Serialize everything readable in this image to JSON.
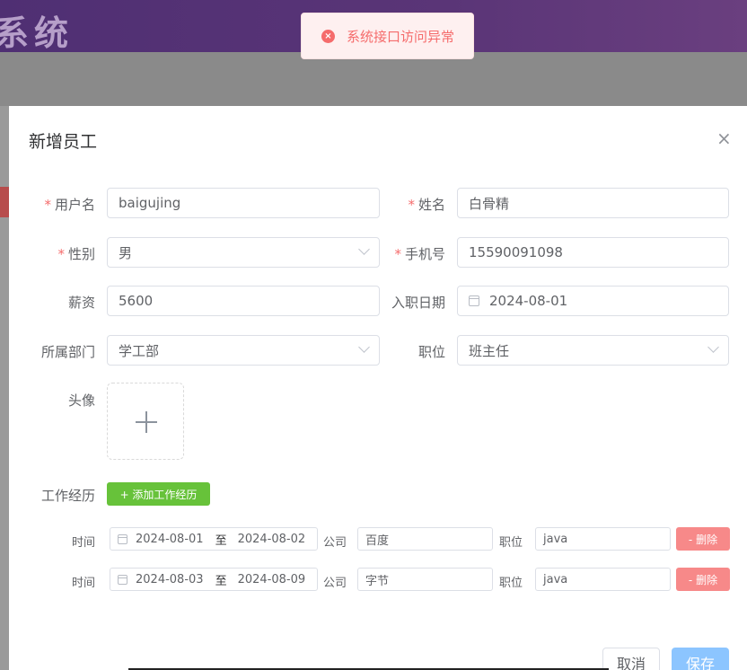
{
  "app": {
    "title": "系统"
  },
  "toast": {
    "message": "系统接口访问异常"
  },
  "dialog": {
    "title": "新增员工",
    "close_glyph": "×",
    "fields": {
      "username": {
        "label": "用户名",
        "value": "baigujing"
      },
      "name": {
        "label": "姓名",
        "value": "白骨精"
      },
      "gender": {
        "label": "性别",
        "value": "男"
      },
      "phone": {
        "label": "手机号",
        "value": "15590091098"
      },
      "salary": {
        "label": "薪资",
        "value": "5600"
      },
      "entry_date": {
        "label": "入职日期",
        "value": "2024-08-01"
      },
      "dept": {
        "label": "所属部门",
        "value": "学工部"
      },
      "job": {
        "label": "职位",
        "value": "班主任"
      },
      "avatar": {
        "label": "头像"
      }
    },
    "work_history": {
      "label": "工作经历",
      "add_button": "+ 添加工作经历",
      "time_label": "时间",
      "company_label": "公司",
      "position_label": "职位",
      "range_sep": "至",
      "delete_button": "- 删除",
      "rows": [
        {
          "start": "2024-08-01",
          "end": "2024-08-02",
          "company": "百度",
          "position": "java"
        },
        {
          "start": "2024-08-03",
          "end": "2024-08-09",
          "company": "字节",
          "position": "java"
        }
      ]
    },
    "footer": {
      "cancel": "取消",
      "save": "保存"
    }
  },
  "colors": {
    "header": "#5a3577",
    "required": "#f56c6c",
    "success": "#67c23a",
    "danger": "#f78989",
    "primary_light": "#8cc5ff"
  }
}
